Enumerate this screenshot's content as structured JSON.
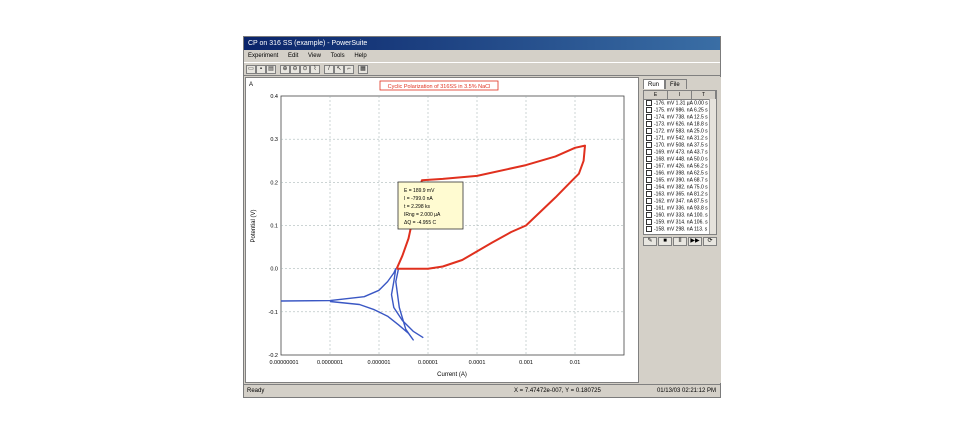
{
  "window": {
    "title": "CP on 316 SS (example) - PowerSuite"
  },
  "menu": [
    "Experiment",
    "Edit",
    "View",
    "Tools",
    "Help"
  ],
  "toolbar": {
    "icons": [
      "open-icon",
      "save-icon",
      "print-icon",
      "zoom-in-icon",
      "zoom-out-icon",
      "zoom-reset-icon",
      "pen-icon",
      "cursor-icon",
      "graph-icon",
      "table-icon"
    ]
  },
  "chart_label": {
    "letter": "A"
  },
  "chart_data": {
    "type": "line",
    "title": "Cyclic Polarization of 316SS in 3.5% NaCl",
    "xlabel": "Current (A)",
    "ylabel": "Potential (V)",
    "x_scale": "log",
    "xlim": [
      1e-09,
      0.01
    ],
    "ylim": [
      -0.2,
      0.4
    ],
    "x_ticks": [
      "0.00000001",
      "0.0000001",
      "0.000001",
      "0.00001",
      "0.0001",
      "0.001",
      "0.01"
    ],
    "y_ticks": [
      "-0.2",
      "-0.1",
      "0.0",
      "0.1",
      "0.2",
      "0.3",
      "0.4"
    ],
    "series": [
      {
        "color": "#3a57c4",
        "points": [
          [
            1e-09,
            -0.075
          ],
          [
            1e-08,
            -0.074
          ],
          [
            5e-08,
            -0.065
          ],
          [
            1e-07,
            -0.05
          ],
          [
            1.5e-07,
            -0.03
          ],
          [
            2e-07,
            -0.01
          ],
          [
            2.2e-07,
            0.0
          ],
          [
            2e-07,
            -0.03
          ],
          [
            1.8e-07,
            -0.06
          ],
          [
            2e-07,
            -0.09
          ],
          [
            3e-07,
            -0.12
          ],
          [
            5e-07,
            -0.145
          ],
          [
            8e-07,
            -0.16
          ]
        ]
      },
      {
        "color": "#3a57c4",
        "points": [
          [
            1e-08,
            -0.076
          ],
          [
            4e-08,
            -0.083
          ],
          [
            8e-08,
            -0.095
          ],
          [
            1.5e-07,
            -0.11
          ],
          [
            2.5e-07,
            -0.13
          ],
          [
            4e-07,
            -0.15
          ],
          [
            5e-07,
            -0.165
          ],
          [
            3.5e-07,
            -0.14
          ],
          [
            2.6e-07,
            -0.09
          ],
          [
            2.2e-07,
            -0.03
          ],
          [
            2.5e-07,
            0.0
          ]
        ]
      },
      {
        "color": "#e0301e",
        "points": [
          [
            2.3e-07,
            0.0
          ],
          [
            3e-07,
            0.03
          ],
          [
            4e-07,
            0.07
          ],
          [
            5e-07,
            0.12
          ],
          [
            6.5e-07,
            0.175
          ],
          [
            7.5e-07,
            0.205
          ],
          [
            2e-06,
            0.208
          ],
          [
            1e-05,
            0.215
          ],
          [
            0.0001,
            0.24
          ],
          [
            0.0004,
            0.26
          ],
          [
            0.001,
            0.28
          ],
          [
            0.0016,
            0.285
          ],
          [
            0.0015,
            0.25
          ],
          [
            0.0012,
            0.22
          ],
          [
            0.0008,
            0.2
          ],
          [
            0.0004,
            0.165
          ],
          [
            0.0001,
            0.1
          ],
          [
            5e-05,
            0.085
          ],
          [
            2e-05,
            0.06
          ],
          [
            1e-05,
            0.04
          ],
          [
            5e-06,
            0.02
          ],
          [
            2e-06,
            0.005
          ],
          [
            1e-06,
            0.0
          ],
          [
            2.3e-07,
            0.0
          ]
        ]
      }
    ],
    "annotation": {
      "lines": [
        "E = 189.9 mV",
        "I = -799.0 nA",
        "t = 2.298 ks",
        "IRng = 2.000 µA",
        "ΔQ = -4.955 C"
      ]
    }
  },
  "side_panel": {
    "tabs": [
      "Run",
      "File"
    ],
    "columns": [
      "E",
      "I",
      "T"
    ],
    "rows": [
      "-176. mV 1.31 µA  0.00 s",
      "-175. mV 986. nA  6.25 s",
      "-174. mV 738. nA  12.5 s",
      "-173. mV 626. nA  18.8 s",
      "-172. mV 583. nA  25.0 s",
      "-171. mV 542. nA  31.2 s",
      "-170. mV 508. nA  37.5 s",
      "-169. mV 473. nA  43.7 s",
      "-168. mV 448. nA  50.0 s",
      "-167. mV 426. nA  56.2 s",
      "-166. mV 398. nA  62.5 s",
      "-165. mV 390. nA  68.7 s",
      "-164. mV 382. nA  75.0 s",
      "-163. mV 365. nA  81.2 s",
      "-162. mV 347. nA  87.5 s",
      "-161. mV 336. nA  93.8 s",
      "-160. mV 333. nA  100. s",
      "-159. mV 314. nA  106. s",
      "-158. mV 298. nA  113. s"
    ],
    "buttons": [
      "✎",
      "■",
      "II",
      "▶▶",
      "⟳"
    ]
  },
  "statusbar": {
    "left": "Ready",
    "coords": "X = 7.47472e-007, Y = 0.180725",
    "datetime": "01/13/03  02:21:12 PM"
  }
}
